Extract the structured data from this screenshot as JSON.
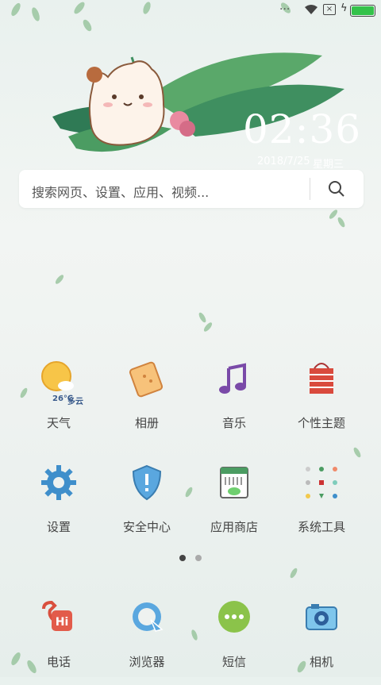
{
  "status_bar": {
    "dots": "···",
    "sim_glyph": "×",
    "charging_glyph": "ϟ",
    "battery_level": 1.0
  },
  "clock": {
    "time": "02:36",
    "date": "2018/7/25",
    "weekday": "星期三"
  },
  "search": {
    "placeholder": "搜索网页、设置、应用、视频..."
  },
  "weather": {
    "temp": "26℃",
    "condition": "多云"
  },
  "apps_row1": [
    {
      "label": "天气",
      "icon": "weather-icon"
    },
    {
      "label": "相册",
      "icon": "gallery-icon"
    },
    {
      "label": "音乐",
      "icon": "music-icon"
    },
    {
      "label": "个性主题",
      "icon": "themes-icon"
    }
  ],
  "apps_row2": [
    {
      "label": "设置",
      "icon": "gear-icon"
    },
    {
      "label": "安全中心",
      "icon": "shield-icon"
    },
    {
      "label": "应用商店",
      "icon": "app-store-icon"
    },
    {
      "label": "系统工具",
      "icon": "tools-folder-icon"
    }
  ],
  "pager": {
    "pages": 2,
    "current": 1
  },
  "dock": [
    {
      "label": "电话",
      "icon": "phone-icon"
    },
    {
      "label": "浏览器",
      "icon": "browser-icon"
    },
    {
      "label": "短信",
      "icon": "messages-icon"
    },
    {
      "label": "相机",
      "icon": "camera-icon"
    }
  ],
  "colors": {
    "accent_green": "#34c24a",
    "leaf": "#7fb68a",
    "label": "#444444"
  }
}
